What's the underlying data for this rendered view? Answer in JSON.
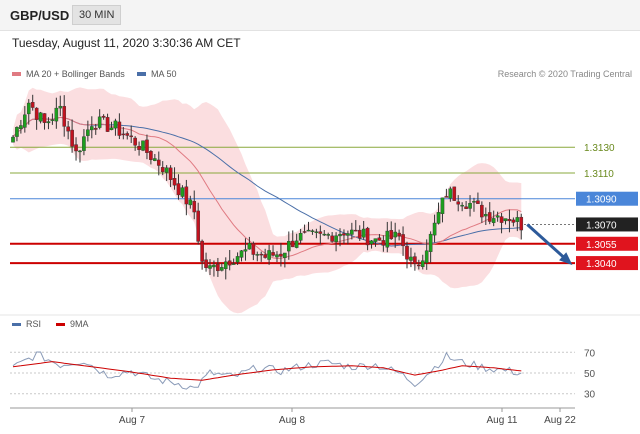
{
  "header": {
    "symbol": "GBP/USD",
    "timeframe": "30 MIN"
  },
  "datetime": "Tuesday, August 11, 2020 3:30:36 AM CET",
  "legend": {
    "bb_label": "MA 20 + Bollinger Bands",
    "ma50_label": "MA 50",
    "credit": "Research © 2020 Trading Central"
  },
  "rsi_legend": {
    "rsi_label": "RSI",
    "ma_label": "9MA"
  },
  "colors": {
    "bullish": "#1e9e1e",
    "bearish": "#c1121f",
    "bands": "#f7c3c6",
    "ma20": "#e07a82",
    "ma50": "#4a6fa8",
    "support": "#cc0000",
    "resistance": "#8aa83c",
    "pivot": "#4a86d9",
    "last": "#222222",
    "arrow": "#2d5a9a"
  },
  "chart_data": [
    {
      "type": "candlestick",
      "title": "GBP/USD 30 MIN",
      "x_ticks": [
        "Aug 7",
        "Aug 8",
        "Aug 11",
        "Aug 22"
      ],
      "ylim": [
        1.3002,
        1.3176
      ],
      "levels": [
        {
          "value": 1.313,
          "label": "1.3130",
          "kind": "resistance"
        },
        {
          "value": 1.311,
          "label": "1.3110",
          "kind": "resistance"
        },
        {
          "value": 1.309,
          "label": "1.3090",
          "kind": "pivot"
        },
        {
          "value": 1.307,
          "label": "1.3070",
          "kind": "last"
        },
        {
          "value": 1.3055,
          "label": "1.3055",
          "kind": "support"
        },
        {
          "value": 1.304,
          "label": "1.3040",
          "kind": "support"
        }
      ],
      "anchors": [
        [
          0,
          1.3138
        ],
        [
          4,
          1.3165
        ],
        [
          8,
          1.3148
        ],
        [
          12,
          1.316
        ],
        [
          16,
          1.3125
        ],
        [
          20,
          1.315
        ],
        [
          26,
          1.3145
        ],
        [
          32,
          1.3132
        ],
        [
          38,
          1.3115
        ],
        [
          42,
          1.3098
        ],
        [
          46,
          1.308
        ],
        [
          48,
          1.304
        ],
        [
          50,
          1.3035
        ],
        [
          56,
          1.3045
        ],
        [
          60,
          1.305
        ],
        [
          64,
          1.3045
        ],
        [
          68,
          1.3048
        ],
        [
          72,
          1.306
        ],
        [
          78,
          1.306
        ],
        [
          84,
          1.3065
        ],
        [
          88,
          1.3062
        ],
        [
          92,
          1.3058
        ],
        [
          98,
          1.306
        ],
        [
          102,
          1.3035
        ],
        [
          106,
          1.306
        ],
        [
          110,
          1.3095
        ],
        [
          114,
          1.309
        ],
        [
          120,
          1.3078
        ],
        [
          126,
          1.3076
        ],
        [
          129,
          1.307
        ]
      ],
      "forecast": {
        "from": 1.307,
        "to": 1.304
      }
    },
    {
      "type": "line",
      "title": "RSI",
      "y_ticks": [
        70,
        50,
        30
      ],
      "ylim": [
        22,
        78
      ],
      "series": [
        {
          "name": "RSI",
          "anchors": [
            [
              0,
              55
            ],
            [
              6,
              68
            ],
            [
              12,
              58
            ],
            [
              18,
              62
            ],
            [
              24,
              48
            ],
            [
              30,
              52
            ],
            [
              36,
              44
            ],
            [
              42,
              40
            ],
            [
              46,
              35
            ],
            [
              50,
              50
            ],
            [
              56,
              46
            ],
            [
              62,
              55
            ],
            [
              68,
              52
            ],
            [
              74,
              57
            ],
            [
              80,
              60
            ],
            [
              86,
              56
            ],
            [
              92,
              58
            ],
            [
              98,
              50
            ],
            [
              102,
              40
            ],
            [
              106,
              52
            ],
            [
              110,
              66
            ],
            [
              114,
              60
            ],
            [
              120,
              55
            ],
            [
              126,
              52
            ],
            [
              129,
              50
            ]
          ]
        },
        {
          "name": "9MA",
          "anchors": [
            [
              0,
              56
            ],
            [
              10,
              61
            ],
            [
              20,
              56
            ],
            [
              30,
              51
            ],
            [
              40,
              45
            ],
            [
              48,
              43
            ],
            [
              56,
              48
            ],
            [
              66,
              53
            ],
            [
              76,
              56
            ],
            [
              86,
              57
            ],
            [
              94,
              55
            ],
            [
              102,
              48
            ],
            [
              108,
              52
            ],
            [
              114,
              57
            ],
            [
              122,
              55
            ],
            [
              129,
              52
            ]
          ]
        }
      ]
    }
  ]
}
